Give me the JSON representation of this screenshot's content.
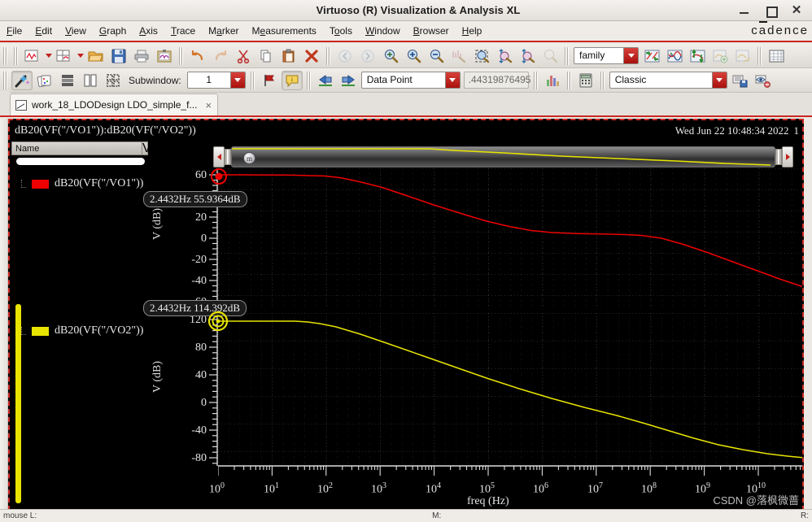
{
  "window": {
    "title": "Virtuoso (R) Visualization & Analysis XL",
    "minimize": "minimize-button",
    "maximize": "maximize-button",
    "close": "close-button"
  },
  "menubar": {
    "items": [
      "File",
      "Edit",
      "View",
      "Graph",
      "Axis",
      "Trace",
      "Marker",
      "Measurements",
      "Tools",
      "Window",
      "Browser",
      "Help"
    ],
    "brand": "cadence"
  },
  "toolbar_row1": {
    "icons": [
      "new-graph-icon",
      "new-graph-dropdown",
      "new-subwindow-icon",
      "new-subwindow-dropdown",
      "open-folder-icon",
      "save-icon",
      "print-icon",
      "export-image-icon",
      "undo-icon",
      "redo-icon",
      "cut-icon",
      "copy-icon",
      "paste-icon",
      "delete-icon",
      "zoom-back-icon",
      "zoom-forward-icon",
      "zoom-fit-icon",
      "zoom-in-icon",
      "zoom-out-icon",
      "zoom-vertical-icon",
      "zoom-area-icon",
      "zoom-x-icon",
      "zoom-y-icon",
      "zoom-select-icon"
    ],
    "family_combo": "family",
    "family_icons": [
      "swap-traces-icon",
      "split-traces-icon",
      "move-trace-icon",
      "append-trace-icon",
      "copy-trace-icon"
    ],
    "grid_icon": "grid-icon"
  },
  "toolbar_row2": {
    "icons": [
      "wand-icon",
      "cards-icon",
      "stack-horizontal-icon",
      "stack-vertical-icon",
      "tile-grid-icon"
    ],
    "subwindow_label": "Subwindow:",
    "subwindow_value": "1",
    "flag_icon": "flag-icon",
    "annotation_icon": "annotation-icon",
    "prev_icon": "previous-marker-icon",
    "next_icon": "next-marker-icon",
    "marker_mode": "Data Point",
    "marker_value": ".44319876495",
    "histogram_icon": "histogram-icon",
    "calculator_icon": "calculator-icon",
    "style_combo": "Classic",
    "save_style_icon": "save-style-icon",
    "hide-style_icon": "hide-style-icon"
  },
  "tab": {
    "icon": "plot-tab-icon",
    "label": "work_18_LDODesign LDO_simple_f...",
    "close": "×"
  },
  "graph_window": {
    "title": "dB20(VF(\"/VO1\")):dB20(VF(\"/VO2\"))",
    "date": "Wed Jun 22 10:48:34 2022",
    "date_extra": "1"
  },
  "legend": {
    "header_name": "Name",
    "header_second": "V",
    "items": [
      {
        "label": "dB20(VF(\"/VO1\"))",
        "color": "#ee0000"
      },
      {
        "label": "dB20(VF(\"/VO2\"))",
        "color": "#e8e400"
      }
    ]
  },
  "markers": [
    {
      "label": "2.4432Hz 55.9364dB",
      "color": "#ee0000"
    },
    {
      "label": "2.4432Hz 114.392dB",
      "color": "#e8e400"
    }
  ],
  "watermark": "CSDN @落枫微蔷",
  "statusbar": {
    "left": "mouse L:",
    "middle": "M:",
    "right": "R:"
  },
  "chart_data": [
    {
      "type": "line",
      "title": "dB20(VF(\"/VO1\"))",
      "xlabel": "freq (Hz)",
      "ylabel": "V (dB)",
      "xscale": "log",
      "xlim": [
        1,
        10000000000
      ],
      "ylim": [
        -70,
        62
      ],
      "yticks": [
        60.0,
        40.0,
        20.0,
        0.0,
        -20.0,
        -40.0,
        -60.0
      ],
      "xticks": [
        "10^0",
        "10^1",
        "10^2",
        "10^3",
        "10^4",
        "10^5",
        "10^6",
        "10^7",
        "10^8",
        "10^9",
        "10^10"
      ],
      "grid": true,
      "legend": "left",
      "series": [
        {
          "name": "dB20(VF(\"/VO1\"))",
          "color": "#ee0000",
          "x": [
            1,
            2.4432,
            10,
            100,
            300,
            1000,
            3000,
            10000,
            30000,
            100000,
            300000,
            1000000,
            3000000,
            10000000,
            30000000,
            100000000,
            300000000,
            1000000000,
            3000000000,
            10000000000
          ],
          "y": [
            55.94,
            55.94,
            55.9,
            55.6,
            55.0,
            53.2,
            48.0,
            39.0,
            30.0,
            21.5,
            15.0,
            11.0,
            9.8,
            9.5,
            8.8,
            5.0,
            -3.0,
            -18.0,
            -36.0,
            -54.0
          ]
        }
      ],
      "marker": {
        "x": 2.4432,
        "y": 55.9364,
        "label": "2.4432Hz 55.9364dB"
      }
    },
    {
      "type": "line",
      "title": "dB20(VF(\"/VO2\"))",
      "xlabel": "freq (Hz)",
      "ylabel": "V (dB)",
      "xscale": "log",
      "xlim": [
        1,
        10000000000
      ],
      "ylim": [
        -95,
        125
      ],
      "yticks": [
        120.0,
        80.0,
        40.0,
        0.0,
        -40.0,
        -80.0
      ],
      "xticks": [
        "10^0",
        "10^1",
        "10^2",
        "10^3",
        "10^4",
        "10^5",
        "10^6",
        "10^7",
        "10^8",
        "10^9",
        "10^10"
      ],
      "grid": true,
      "legend": "left",
      "series": [
        {
          "name": "dB20(VF(\"/VO2\"))",
          "color": "#e8e400",
          "x": [
            1,
            2.4432,
            10,
            100,
            1000,
            3000,
            10000,
            100000,
            1000000,
            10000000,
            100000000,
            300000000,
            1000000000,
            3000000000,
            10000000000
          ],
          "y": [
            114.39,
            114.39,
            114.3,
            114.0,
            112.0,
            107.0,
            97.0,
            74.0,
            51.0,
            27.0,
            0.0,
            -13.0,
            -34.0,
            -55.0,
            -72.0
          ]
        }
      ],
      "marker": {
        "x": 2.4432,
        "y": 114.392,
        "label": "2.4432Hz 114.392dB"
      }
    }
  ]
}
